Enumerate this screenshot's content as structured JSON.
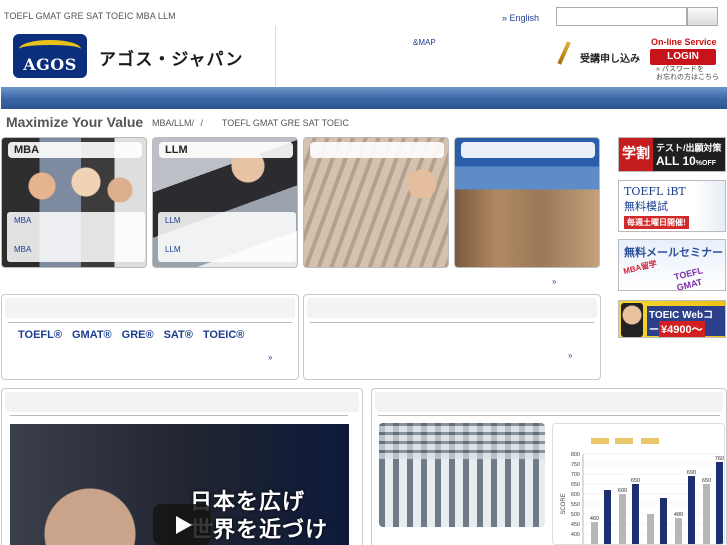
{
  "header": {
    "tagline": "TOEFL GMAT GRE SAT TOEIC   MBA LLM",
    "logo_text": "AGOS",
    "brand_name": "アゴス・ジャパン",
    "language_link": "» English",
    "sitemap_link": "&MAP",
    "apply_label": "受講申し込み",
    "online_service_label": "On-line Service",
    "login_label": "LOGIN",
    "password_note": "» パスワードを\nお忘れの方はこちら"
  },
  "main": {
    "heading": "Maximize Your Value",
    "breadcrumb": [
      "MBA/LLM/",
      "/",
      "TOEFL GMAT GRE SAT TOEIC"
    ],
    "features": [
      {
        "title": "MBA",
        "links": [
          "MBA",
          "MBA"
        ]
      },
      {
        "title": "LLM",
        "links": [
          "LLM",
          "LLM"
        ]
      },
      {
        "title": "",
        "links": []
      },
      {
        "title": "",
        "links": []
      }
    ],
    "feature_more": "»",
    "exams": [
      "TOEFL®",
      "GMAT®",
      "GRE®",
      "SAT®",
      "TOEIC®"
    ],
    "panel_more": "»"
  },
  "banners": [
    {
      "tag": "学割",
      "line1": "テスト/出願対策",
      "line2": "ALL 10",
      "suffix": "%OFF"
    },
    {
      "line1": "TOEFL iBT",
      "line2": "無料模試",
      "line3": "毎週土曜日開催!"
    },
    {
      "line1": "無料メールセミナー",
      "line2": "MBA留学",
      "line3": "TOEFL GMAT"
    },
    {
      "line1": "TOEIC Webコース",
      "line2": "¥4900～"
    }
  ],
  "video": {
    "caption_line1": "日本を広げ",
    "caption_line2": "世界を近づける"
  },
  "chart_data": {
    "type": "bar",
    "ylabel": "SCORE",
    "ylim": [
      350,
      800
    ],
    "yticks": [
      400,
      450,
      500,
      550,
      600,
      650,
      700,
      750,
      800
    ],
    "series": [
      {
        "values": [
          460,
          600,
          500,
          480,
          650
        ]
      },
      {
        "values": [
          620,
          650,
          580,
          690,
          760
        ]
      }
    ],
    "bar_labels": [
      [
        "460",
        "600",
        "",
        "480",
        "650"
      ],
      [
        "",
        "650",
        "",
        "690",
        "760"
      ]
    ],
    "colors": {
      "dark": "#1e2f6e",
      "gray": "#b7b7b7"
    }
  }
}
